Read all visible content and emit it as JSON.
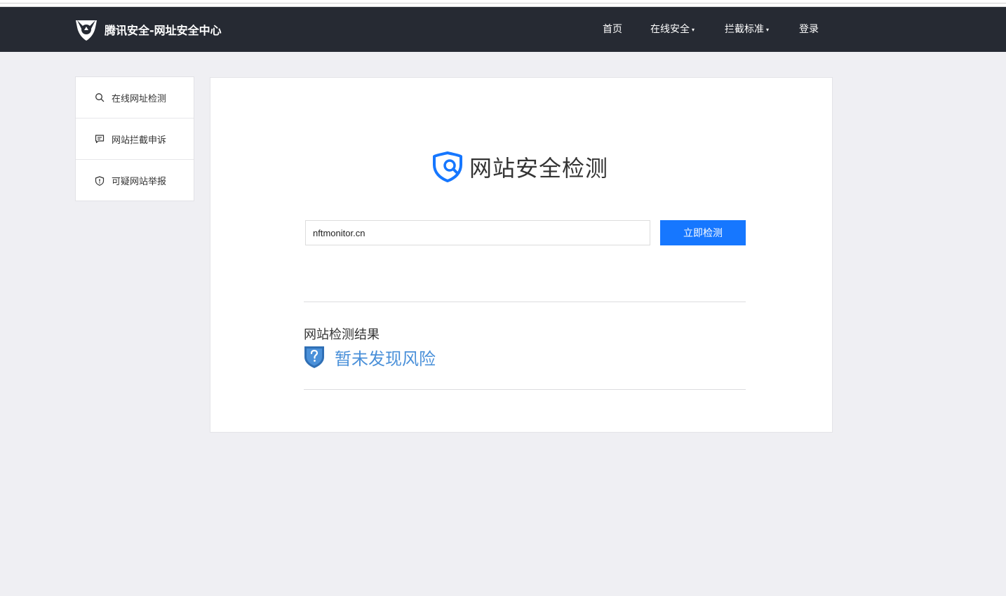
{
  "header": {
    "brand_title": "腾讯安全-网址安全中心",
    "nav": [
      {
        "label": "首页",
        "has_dropdown": false
      },
      {
        "label": "在线安全",
        "has_dropdown": true
      },
      {
        "label": "拦截标准",
        "has_dropdown": true
      },
      {
        "label": "登录",
        "has_dropdown": false
      }
    ],
    "caret": "▾"
  },
  "sidebar": {
    "items": [
      {
        "label": "在线网址检测",
        "icon": "search-icon"
      },
      {
        "label": "网站拦截申诉",
        "icon": "message-icon"
      },
      {
        "label": "可疑网站举报",
        "icon": "shield-alert-icon"
      }
    ]
  },
  "main": {
    "hero_title": "网站安全检测",
    "url_input_value": "nftmonitor.cn",
    "check_button_label": "立即检测",
    "result_title": "网站检测结果",
    "result_status": "暂未发现风险",
    "result_icon": "shield-question-icon"
  },
  "colors": {
    "navbar": "#262a33",
    "accent": "#1677ff",
    "status": "#4a90d9",
    "background": "#efeff3"
  }
}
